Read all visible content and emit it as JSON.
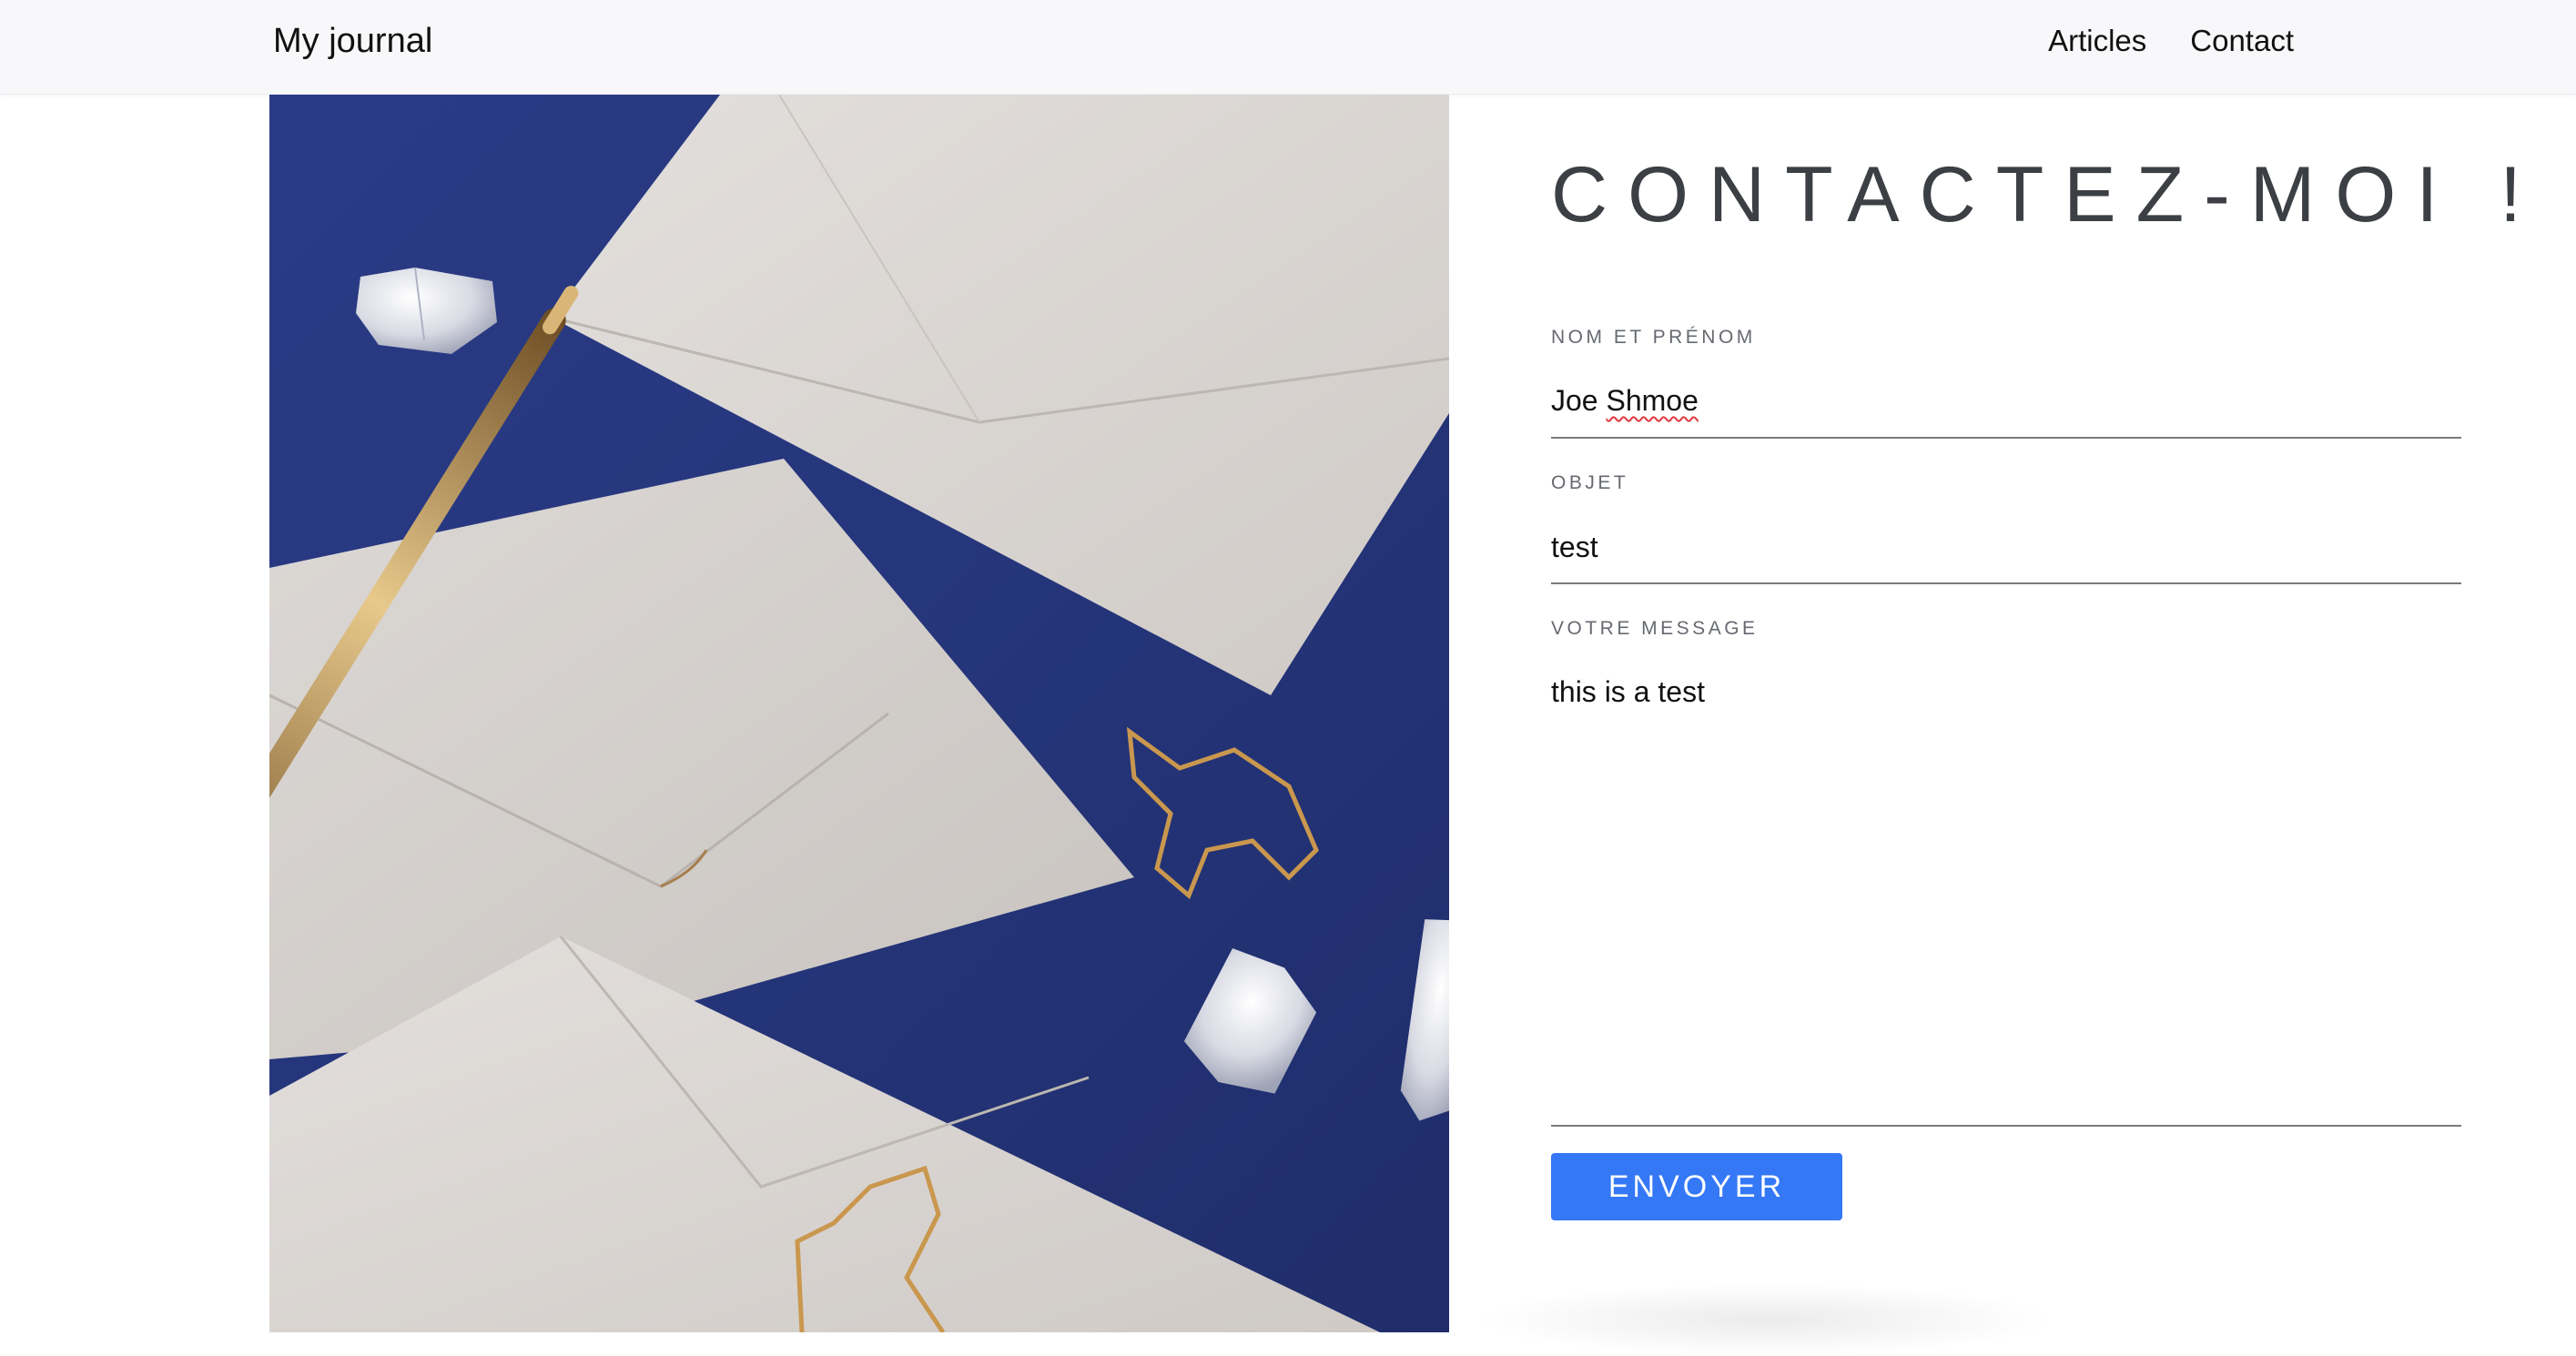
{
  "navbar": {
    "brand": "My journal",
    "links": [
      "Articles",
      "Contact"
    ]
  },
  "contact": {
    "title": "CONTACTEZ-MOI !",
    "fields": {
      "name": {
        "label": "NOM ET PRÉNOM",
        "first": "Joe",
        "last": "Shmoe"
      },
      "subject": {
        "label": "OBJET",
        "value": "test"
      },
      "message": {
        "label": "VOTRE MESSAGE",
        "value": "this is a test"
      }
    },
    "submit_label": "ENVOYER"
  },
  "colors": {
    "accent": "#3478f6",
    "photo_background": "#26367c",
    "heading": "#3c3f44"
  },
  "icons": {
    "photo": "envelopes-crystals-pen-photo"
  }
}
